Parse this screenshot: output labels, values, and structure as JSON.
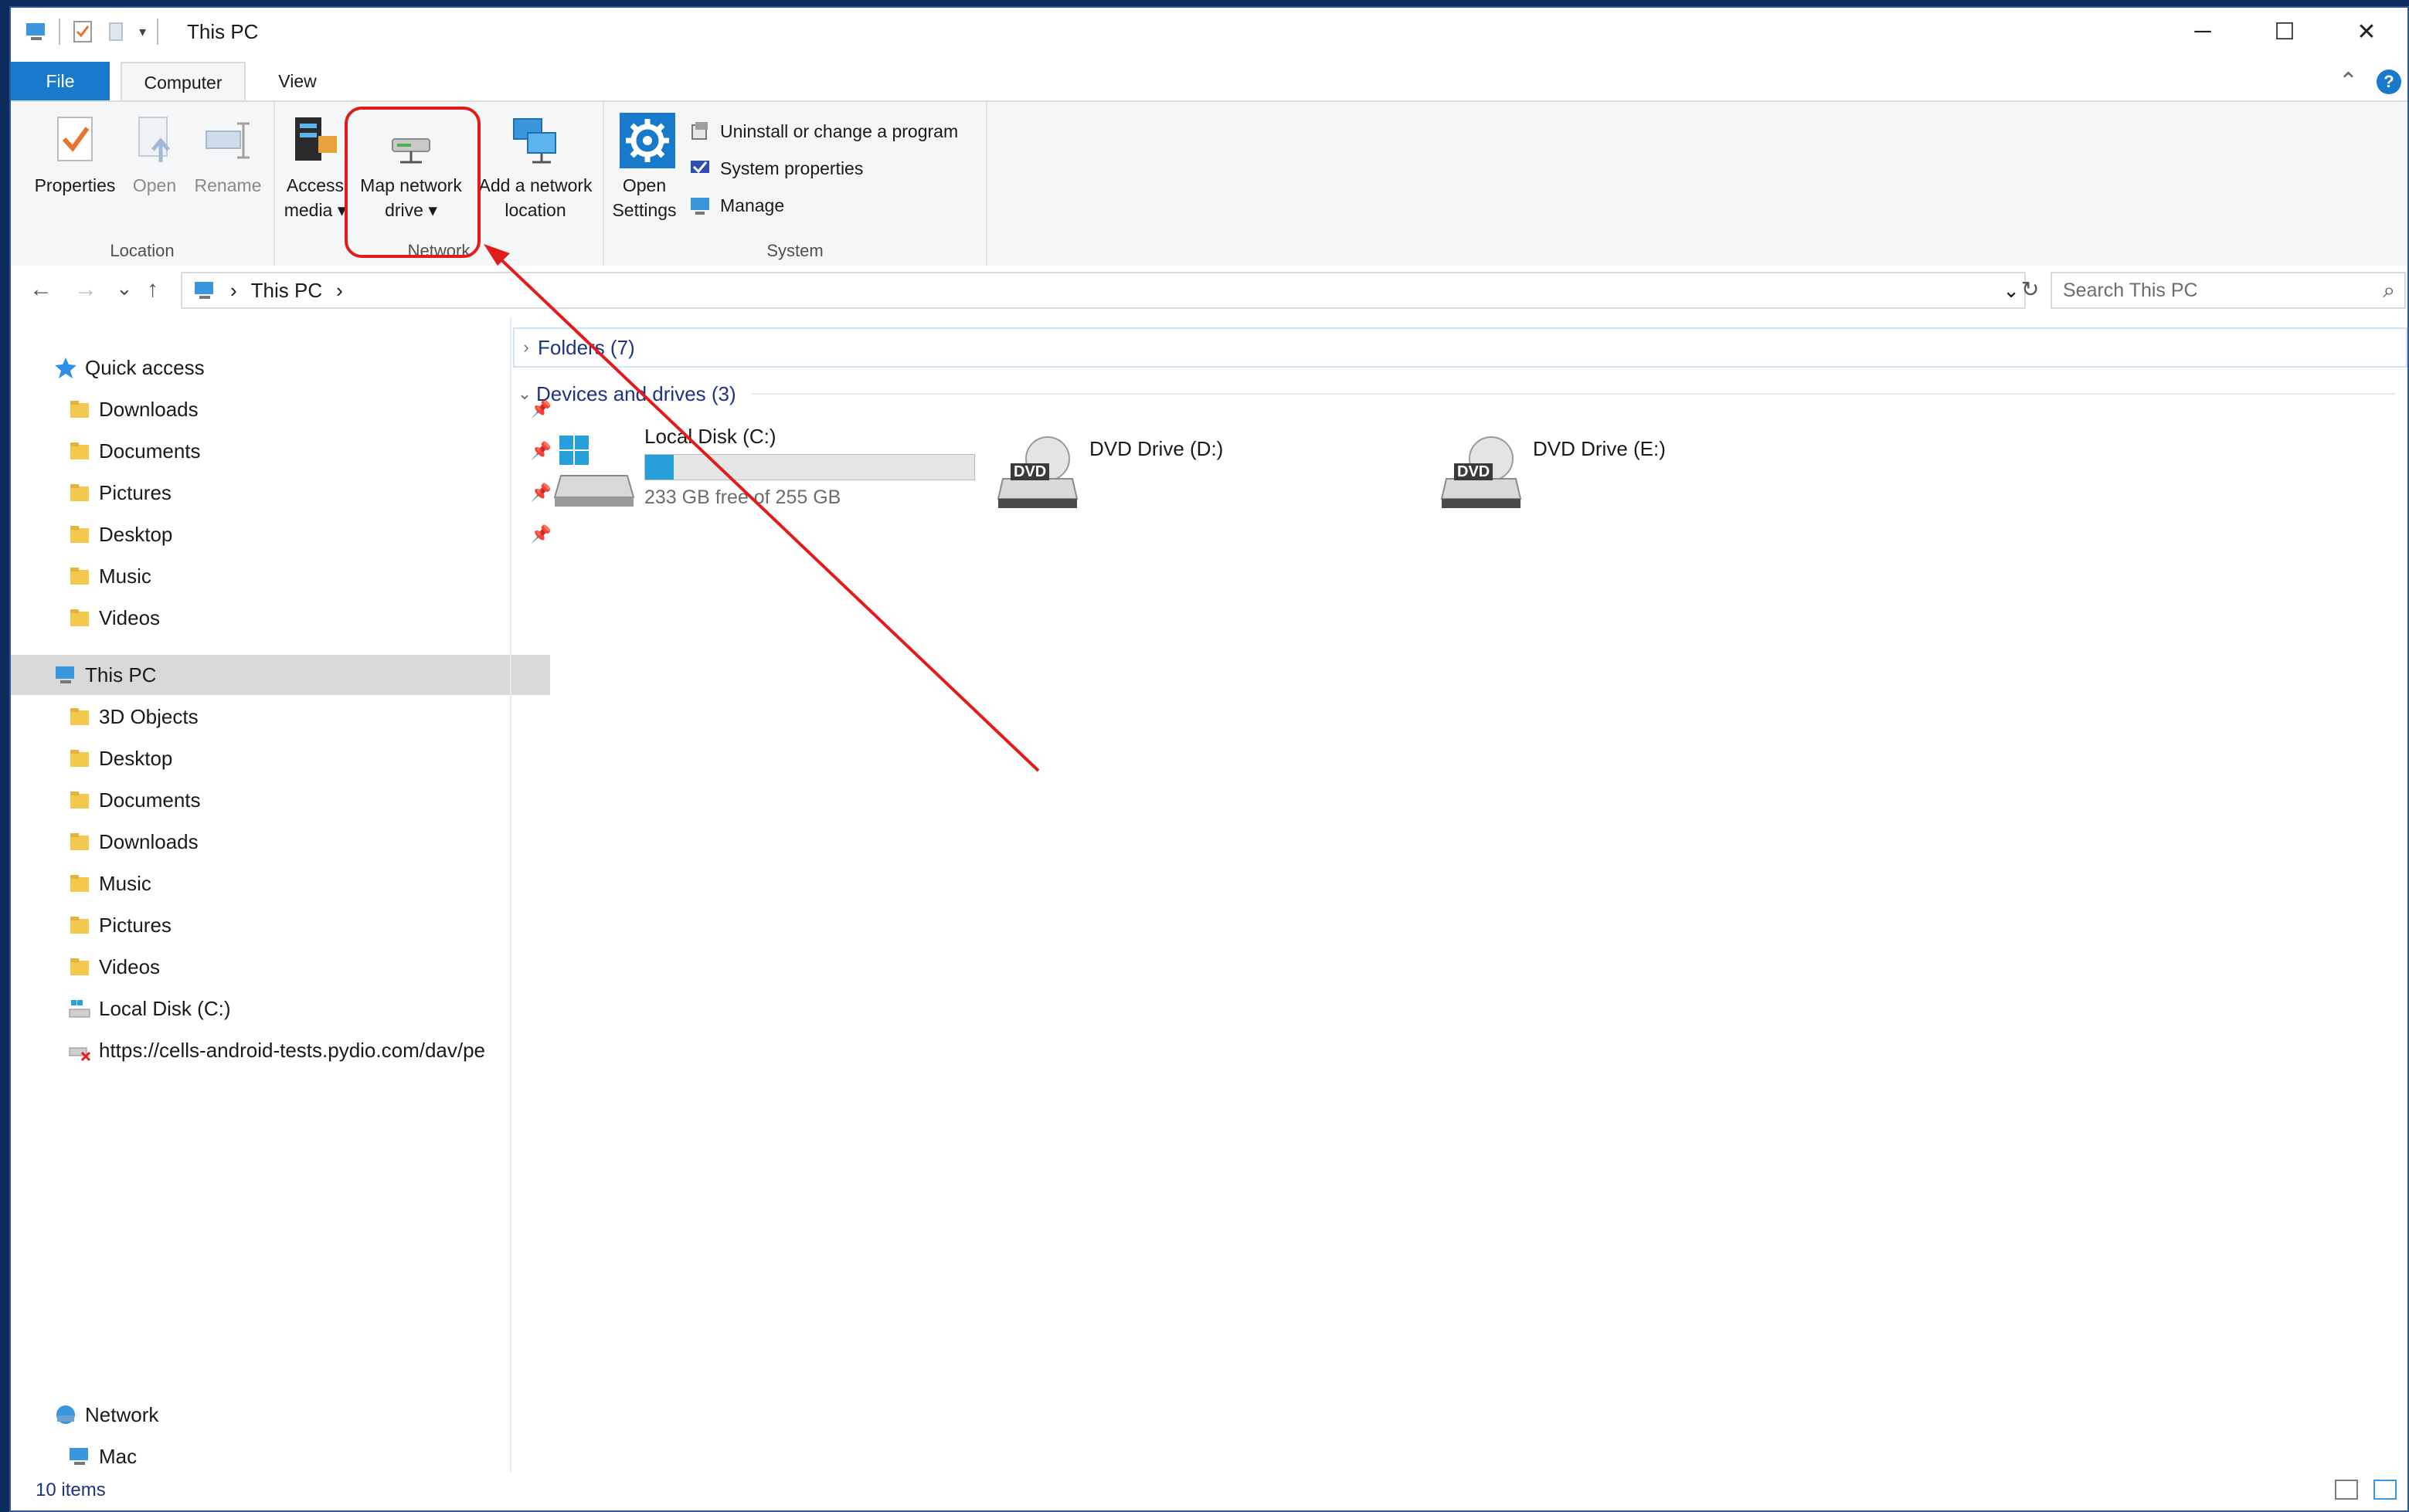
{
  "window": {
    "title": "This PC"
  },
  "qat": {
    "customize_label": "▾"
  },
  "window_controls": {
    "minimize": "─",
    "maximize": "☐",
    "close": "✕"
  },
  "tabs": {
    "file": "File",
    "computer": "Computer",
    "view": "View"
  },
  "ribbon": {
    "collapse": "⌃",
    "help": "?",
    "location": {
      "label": "Location",
      "properties": "Properties",
      "open": "Open",
      "rename": "Rename"
    },
    "network": {
      "label": "Network",
      "access_media_line1": "Access",
      "access_media_line2": "media ▾",
      "map_drive_line1": "Map network",
      "map_drive_line2": "drive ▾",
      "add_location_line1": "Add a network",
      "add_location_line2": "location"
    },
    "system": {
      "label": "System",
      "open_settings_line1": "Open",
      "open_settings_line2": "Settings",
      "uninstall": "Uninstall or change a program",
      "system_properties": "System properties",
      "manage": "Manage"
    }
  },
  "address": {
    "back": "←",
    "forward": "→",
    "recent": "⌄",
    "up": "↑",
    "separator1": "›",
    "location": "This PC",
    "separator2": "›",
    "dropdown": "⌄",
    "refresh": "↻",
    "search_placeholder": "Search This PC",
    "search_icon": "⌕"
  },
  "nav": {
    "quick_access": "Quick access",
    "qa_items": [
      "Downloads",
      "Documents",
      "Pictures",
      "Desktop",
      "Music",
      "Videos"
    ],
    "pin": "📌",
    "this_pc": "This PC",
    "pc_items": [
      "3D Objects",
      "Desktop",
      "Documents",
      "Downloads",
      "Music",
      "Pictures",
      "Videos",
      "Local Disk (C:)",
      "https://cells-android-tests.pydio.com/dav/pe"
    ],
    "network": "Network",
    "mac": "Mac"
  },
  "content": {
    "folders_header": "Folders (7)",
    "devices_header": "Devices and drives (3)",
    "drives": [
      {
        "name": "Local Disk (C:)",
        "free": "233 GB free of 255 GB",
        "used_fraction": 0.086
      },
      {
        "name": "DVD Drive (D:)",
        "badge": "DVD"
      },
      {
        "name": "DVD Drive (E:)",
        "badge": "DVD"
      }
    ]
  },
  "status": {
    "items": "10 items"
  },
  "colors": {
    "accent": "#1979ca",
    "annotation": "#e21b1b",
    "drive_bar": "#26a0da"
  }
}
